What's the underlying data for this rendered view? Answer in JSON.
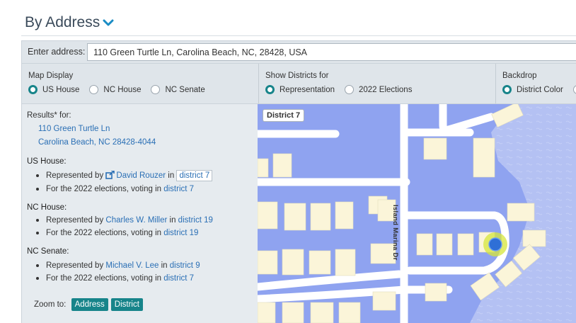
{
  "header": {
    "title": "By Address",
    "chevron_icon": "chevron-down-icon"
  },
  "address": {
    "label": "Enter address:",
    "value": "110 Green Turtle Ln, Carolina Beach, NC, 28428, USA"
  },
  "map_display": {
    "title": "Map Display",
    "options": [
      "US House",
      "NC House",
      "NC Senate"
    ],
    "selected": "US House"
  },
  "show_districts": {
    "title": "Show Districts for",
    "options": [
      "Representation",
      "2022 Elections"
    ],
    "selected": "Representation"
  },
  "backdrop": {
    "title": "Backdrop",
    "options": [
      "District Color"
    ],
    "selected": "District Color"
  },
  "results": {
    "heading": "Results* for:",
    "address_line1": "110 Green Turtle Ln",
    "address_line2": "Carolina Beach, NC  28428-4044",
    "us_house": {
      "title": "US House:",
      "rep_prefix": "Represented by",
      "rep_name": "David Rouzer",
      "in_word": "in",
      "rep_district": "district 7",
      "elec_prefix": "For the 2022 elections, voting in",
      "elec_district": "district 7"
    },
    "nc_house": {
      "title": "NC House:",
      "rep_prefix": "Represented by",
      "rep_name": "Charles W. Miller",
      "in_word": "in",
      "rep_district": "district 19",
      "elec_prefix": "For the 2022 elections, voting in",
      "elec_district": "district 19"
    },
    "nc_senate": {
      "title": "NC Senate:",
      "rep_prefix": "Represented by",
      "rep_name": "Michael V. Lee",
      "in_word": "in",
      "rep_district": "district 9",
      "elec_prefix": "For the 2022 elections, voting in",
      "elec_district": "district 7"
    },
    "zoom": {
      "label": "Zoom to:",
      "address_button": "Address",
      "district_button": "District"
    }
  },
  "map": {
    "district_label": "District 7",
    "street_label": "Island Marina Dr",
    "colors": {
      "district": "#8fa3f0",
      "water": "#b4c1f3",
      "road": "#ffffff",
      "building": "#fbf5d9",
      "marker": "#2f6fd6",
      "marker_halo": "#d6e53a"
    }
  },
  "colors": {
    "accent": "#17848a",
    "link": "#2a6fb5",
    "panel": "#e6ebef"
  }
}
